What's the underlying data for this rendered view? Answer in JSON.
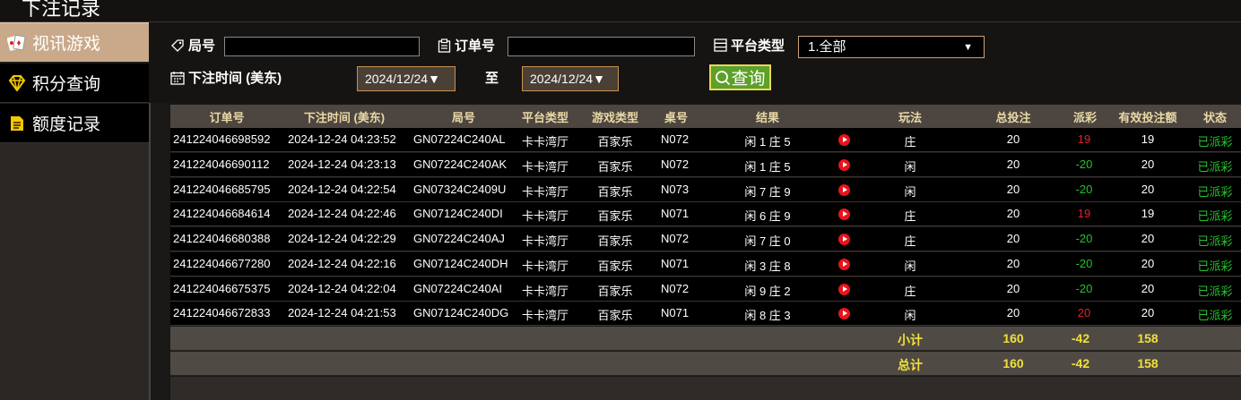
{
  "page_title": "下注记录",
  "sidebar": {
    "items": [
      {
        "label": "视讯游戏",
        "icon": "playing-cards-icon"
      },
      {
        "label": "积分查询",
        "icon": "diamond-icon"
      },
      {
        "label": "额度记录",
        "icon": "document-icon"
      }
    ]
  },
  "filters": {
    "round_label": "局号",
    "order_label": "订单号",
    "platform_label": "平台类型",
    "platform_selected": "1.全部",
    "time_label": "下注时间 (美东)",
    "date_from": "2024/12/24▼",
    "to_label": "至",
    "date_to": "2024/12/24▼",
    "query_label": "查询",
    "round_value": "",
    "order_value": ""
  },
  "table": {
    "headers": [
      "订单号",
      "下注时间 (美东)",
      "局号",
      "平台类型",
      "游戏类型",
      "桌号",
      "结果",
      "玩法",
      "总投注",
      "派彩",
      "有效投注额",
      "状态"
    ],
    "rows": [
      {
        "order": "241224046698592",
        "time": "2024-12-24 04:23:52",
        "round": "GN07224C240AL",
        "platform": "卡卡湾厅",
        "game": "百家乐",
        "table": "N072",
        "result": "闲 1 庄 5",
        "bet": "庄",
        "total": "20",
        "payout": "19",
        "valid": "19",
        "status": "已派彩"
      },
      {
        "order": "241224046690112",
        "time": "2024-12-24 04:23:13",
        "round": "GN07224C240AK",
        "platform": "卡卡湾厅",
        "game": "百家乐",
        "table": "N072",
        "result": "闲 1 庄 5",
        "bet": "闲",
        "total": "20",
        "payout": "-20",
        "valid": "20",
        "status": "已派彩"
      },
      {
        "order": "241224046685795",
        "time": "2024-12-24 04:22:54",
        "round": "GN07324C2409U",
        "platform": "卡卡湾厅",
        "game": "百家乐",
        "table": "N073",
        "result": "闲 7 庄 9",
        "bet": "闲",
        "total": "20",
        "payout": "-20",
        "valid": "20",
        "status": "已派彩"
      },
      {
        "order": "241224046684614",
        "time": "2024-12-24 04:22:46",
        "round": "GN07124C240DI",
        "platform": "卡卡湾厅",
        "game": "百家乐",
        "table": "N071",
        "result": "闲 6 庄 9",
        "bet": "庄",
        "total": "20",
        "payout": "19",
        "valid": "19",
        "status": "已派彩"
      },
      {
        "order": "241224046680388",
        "time": "2024-12-24 04:22:29",
        "round": "GN07224C240AJ",
        "platform": "卡卡湾厅",
        "game": "百家乐",
        "table": "N072",
        "result": "闲 7 庄 0",
        "bet": "庄",
        "total": "20",
        "payout": "-20",
        "valid": "20",
        "status": "已派彩"
      },
      {
        "order": "241224046677280",
        "time": "2024-12-24 04:22:16",
        "round": "GN07124C240DH",
        "platform": "卡卡湾厅",
        "game": "百家乐",
        "table": "N071",
        "result": "闲 3 庄 8",
        "bet": "闲",
        "total": "20",
        "payout": "-20",
        "valid": "20",
        "status": "已派彩"
      },
      {
        "order": "241224046675375",
        "time": "2024-12-24 04:22:04",
        "round": "GN07224C240AI",
        "platform": "卡卡湾厅",
        "game": "百家乐",
        "table": "N072",
        "result": "闲 9 庄 2",
        "bet": "庄",
        "total": "20",
        "payout": "-20",
        "valid": "20",
        "status": "已派彩"
      },
      {
        "order": "241224046672833",
        "time": "2024-12-24 04:21:53",
        "round": "GN07124C240DG",
        "platform": "卡卡湾厅",
        "game": "百家乐",
        "table": "N071",
        "result": "闲 8 庄 3",
        "bet": "闲",
        "total": "20",
        "payout": "20",
        "valid": "20",
        "status": "已派彩"
      }
    ],
    "subtotal": {
      "label": "小计",
      "total": "160",
      "payout": "-42",
      "valid": "158"
    },
    "grandtotal": {
      "label": "总计",
      "total": "160",
      "payout": "-42",
      "valid": "158"
    }
  },
  "colors": {
    "accent": "#c9a98a",
    "win": "#e0232c",
    "loss": "#27c22f",
    "query_button": "#5da02a",
    "header_text": "#ead9a5",
    "total_text": "#f0e03a"
  }
}
